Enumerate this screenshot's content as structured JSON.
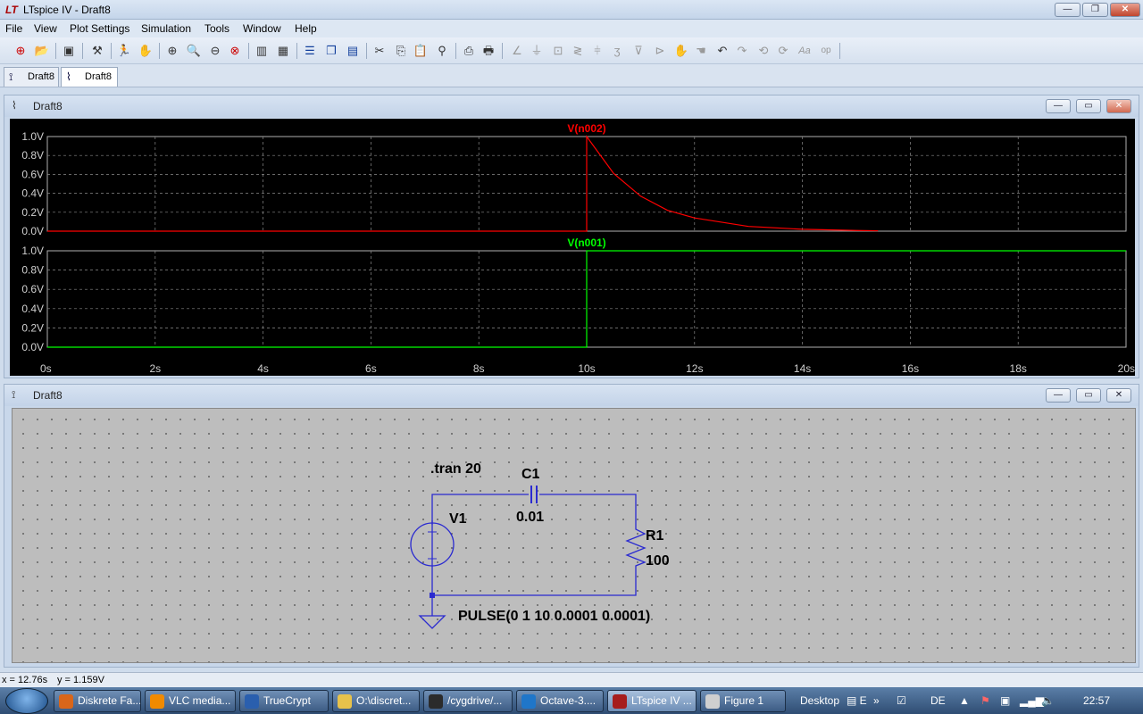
{
  "app": {
    "title": "LTspice IV - Draft8"
  },
  "menu": [
    "File",
    "View",
    "Plot Settings",
    "Simulation",
    "Tools",
    "Window",
    "Help"
  ],
  "tabs": [
    {
      "label": "Draft8",
      "icon": "schematic-icon"
    },
    {
      "label": "Draft8",
      "icon": "waveform-icon"
    }
  ],
  "plot_window": {
    "title": "Draft8"
  },
  "schematic_window": {
    "title": "Draft8"
  },
  "chart_data": [
    {
      "type": "line",
      "title": "V(n002)",
      "color": "#ff0000",
      "xlim": [
        0,
        20
      ],
      "ylim": [
        0,
        1.0
      ],
      "xticks": [
        "0s",
        "2s",
        "4s",
        "6s",
        "8s",
        "10s",
        "12s",
        "14s",
        "16s",
        "18s",
        "20s"
      ],
      "yticks": [
        "0.0V",
        "0.2V",
        "0.4V",
        "0.6V",
        "0.8V",
        "1.0V"
      ],
      "series": [
        {
          "name": "V(n002)",
          "x": [
            0,
            10,
            10,
            10.5,
            11,
            11.5,
            12,
            13,
            14,
            15,
            15.4
          ],
          "y": [
            0,
            0,
            1.0,
            0.61,
            0.37,
            0.22,
            0.14,
            0.05,
            0.02,
            0.007,
            0.004
          ]
        }
      ],
      "grid": true
    },
    {
      "type": "line",
      "title": "V(n001)",
      "color": "#00ff00",
      "xlim": [
        0,
        20
      ],
      "ylim": [
        0,
        1.0
      ],
      "yticks": [
        "0.0V",
        "0.2V",
        "0.4V",
        "0.6V",
        "0.8V",
        "1.0V"
      ],
      "series": [
        {
          "name": "V(n001)",
          "x": [
            0,
            10,
            10,
            20
          ],
          "y": [
            0,
            0,
            1.0,
            1.0
          ]
        }
      ],
      "grid": true
    }
  ],
  "schematic": {
    "directive": ".tran 20",
    "c1_name": "C1",
    "c1_value": "0.01",
    "v1_name": "V1",
    "r1_name": "R1",
    "r1_value": "100",
    "v1_value": "PULSE(0 1 10 0.0001 0.0001)"
  },
  "status": {
    "x": "x = 12.76s",
    "y": "y = 1.159V"
  },
  "taskbar": {
    "items": [
      {
        "label": "Diskrete Fa...",
        "color": "#d9661a"
      },
      {
        "label": "VLC media...",
        "color": "#f08a00"
      },
      {
        "label": "TrueCrypt",
        "color": "#2a5fae"
      },
      {
        "label": "O:\\discret...",
        "color": "#e7c24b"
      },
      {
        "label": "/cygdrive/...",
        "color": "#2b2b2b"
      },
      {
        "label": "Octave-3....",
        "color": "#1f76c9"
      },
      {
        "label": "LTspice IV ...",
        "color": "#a61d1d"
      },
      {
        "label": "Figure 1",
        "color": "#cfcfcf"
      }
    ],
    "desktop": "Desktop",
    "lang": "DE",
    "clock": "22:57"
  }
}
